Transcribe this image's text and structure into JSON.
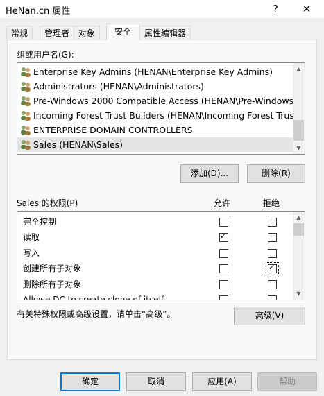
{
  "window": {
    "title": "HeNan.cn 属性",
    "help_glyph": "?",
    "close_glyph": "✕"
  },
  "tabs": [
    {
      "label": "常规",
      "active": false
    },
    {
      "label": "管理者",
      "active": false
    },
    {
      "label": "对象",
      "active": false
    },
    {
      "label": "安全",
      "active": true
    },
    {
      "label": "属性编辑器",
      "active": false
    }
  ],
  "groups": {
    "label": "组或用户名(G):",
    "items": [
      {
        "label": "Enterprise Key Admins (HENAN\\Enterprise Key Admins)",
        "icon": "users-group-icon"
      },
      {
        "label": "Administrators (HENAN\\Administrators)",
        "icon": "users-group-icon"
      },
      {
        "label": "Pre-Windows 2000 Compatible Access (HENAN\\Pre-Windows ...",
        "icon": "users-group-icon"
      },
      {
        "label": "Incoming Forest Trust Builders (HENAN\\Incoming Forest Trust...",
        "icon": "users-group-icon"
      },
      {
        "label": "ENTERPRISE DOMAIN CONTROLLERS",
        "icon": "users-group-icon"
      },
      {
        "label": "Sales (HENAN\\Sales)",
        "icon": "users-group-icon",
        "selected": true
      }
    ],
    "add_button": "添加(D)...",
    "remove_button": "删除(R)"
  },
  "permissions": {
    "label": "Sales 的权限(P)",
    "allow_header": "允许",
    "deny_header": "拒绝",
    "rows": [
      {
        "label": "完全控制",
        "allow": false,
        "deny": false
      },
      {
        "label": "读取",
        "allow": true,
        "deny": false
      },
      {
        "label": "写入",
        "allow": false,
        "deny": false
      },
      {
        "label": "创建所有子对象",
        "allow": false,
        "deny": true
      },
      {
        "label": "删除所有子对象",
        "allow": false,
        "deny": false
      },
      {
        "label": "Allowe DC to create clone of itself",
        "allow": false,
        "deny": false
      }
    ],
    "advanced_hint": "有关特殊权限或高级设置，请单击“高级”。",
    "advanced_button": "高级(V)"
  },
  "footer": {
    "ok": "确定",
    "cancel": "取消",
    "apply": "应用(A)",
    "help": "帮助"
  }
}
